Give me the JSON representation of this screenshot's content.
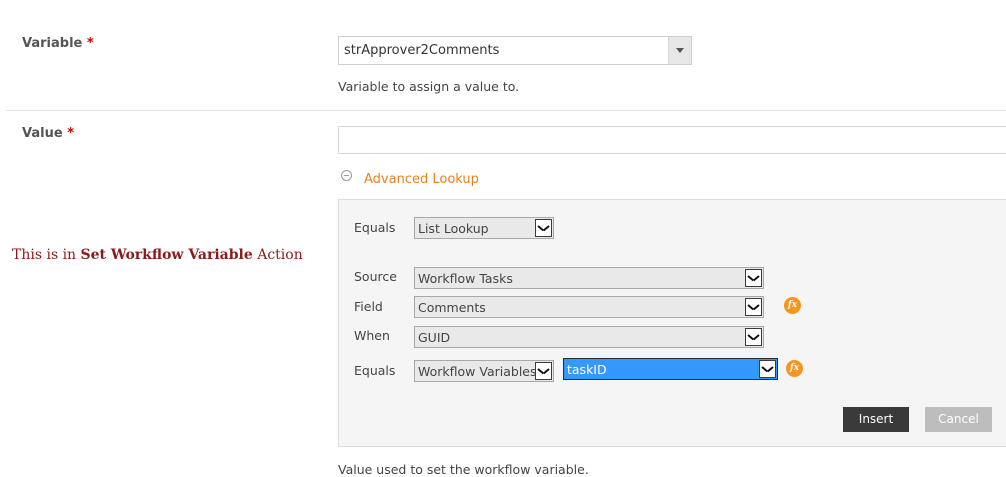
{
  "variable": {
    "label": "Variable",
    "required_mark": "*",
    "selected_value": "strApprover2Comments",
    "help": "Variable to assign a value to."
  },
  "value": {
    "label": "Value",
    "required_mark": "*",
    "input_value": "",
    "help": "Value used to set the workflow variable."
  },
  "advanced_lookup": {
    "toggle_label": "Advanced Lookup",
    "equals_label": "Equals",
    "equals_value": "List Lookup",
    "source_label": "Source",
    "source_value": "Workflow Tasks",
    "field_label": "Field",
    "field_value": "Comments",
    "when_label": "When",
    "when_value": "GUID",
    "equals2_label": "Equals",
    "equals2_value": "Workflow Variables",
    "equals2_sub_value": "taskID",
    "fx_label": "fx",
    "insert_label": "Insert",
    "cancel_label": "Cancel"
  },
  "note": {
    "prefix": "This is in",
    "bold": "Set Workflow Variable",
    "suffix": "Action"
  },
  "colors": {
    "accent_orange": "#e8821f",
    "required_red": "#cc0000",
    "selection_blue": "#3399ff",
    "insert_bg": "#3a3a3a",
    "cancel_bg": "#bdbdbd",
    "note_red": "#8b1a1a"
  }
}
